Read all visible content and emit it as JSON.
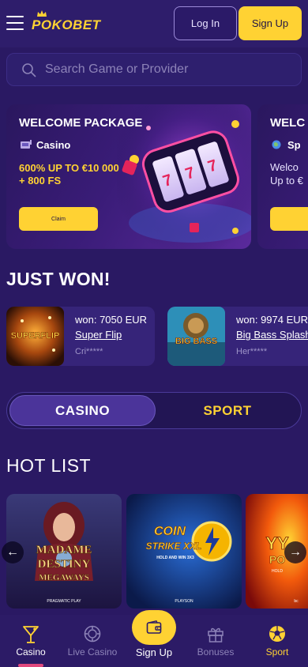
{
  "header": {
    "logo": "POKOBET",
    "login_label": "Log In",
    "signup_label": "Sign Up"
  },
  "search": {
    "placeholder": "Search Game or Provider"
  },
  "banners": [
    {
      "title": "WELCOME PACKAGE",
      "category": "Casino",
      "offer_line1": "600% UP TO €10 000",
      "offer_line2": "+ 800 FS",
      "button": "Claim"
    },
    {
      "title": "WELC",
      "category": "Sp",
      "offer_line1": "Welco",
      "offer_line2": "Up to €"
    }
  ],
  "just_won": {
    "heading": "JUST WON!",
    "items": [
      {
        "amount": "won: 7050 EUR",
        "game": "Super Flip",
        "user": "Cri*****",
        "thumb_text": "SUPERFLIP"
      },
      {
        "amount": "won: 9974 EUR",
        "game": "Big Bass Splash",
        "user": "Her*****",
        "thumb_text": "BIG BASS"
      }
    ]
  },
  "toggle": {
    "casino": "CASINO",
    "sport": "SPORT",
    "active": "casino"
  },
  "hot_list": {
    "heading": "HOT LIST",
    "games": [
      {
        "title_line1": "MADAME",
        "title_line2": "DESTINY",
        "title_line3": "MEGAWAYS",
        "provider": "PRAGMATIC PLAY"
      },
      {
        "title_line1": "COIN",
        "title_line2": "STRIKE XXL",
        "title_line3": "HOLD AND WIN 3X3",
        "provider": "PLAYSON"
      },
      {
        "title_line1": "YY",
        "title_line2": "PO",
        "title_line3": "HOLD",
        "provider": "bc"
      }
    ]
  },
  "bottom_nav": [
    {
      "label": "Casino",
      "icon": "cocktail-icon",
      "active": true
    },
    {
      "label": "Live Casino",
      "icon": "chip-icon",
      "active": false
    },
    {
      "label": "Sign Up",
      "icon": "wallet-icon",
      "active": false
    },
    {
      "label": "Bonuses",
      "icon": "gift-icon",
      "active": false
    },
    {
      "label": "Sport",
      "icon": "soccer-ball-icon",
      "active": false
    }
  ],
  "colors": {
    "background": "#2a1963",
    "accent": "#ffd233",
    "card": "#362479",
    "active_indicator": "#e0487d"
  }
}
